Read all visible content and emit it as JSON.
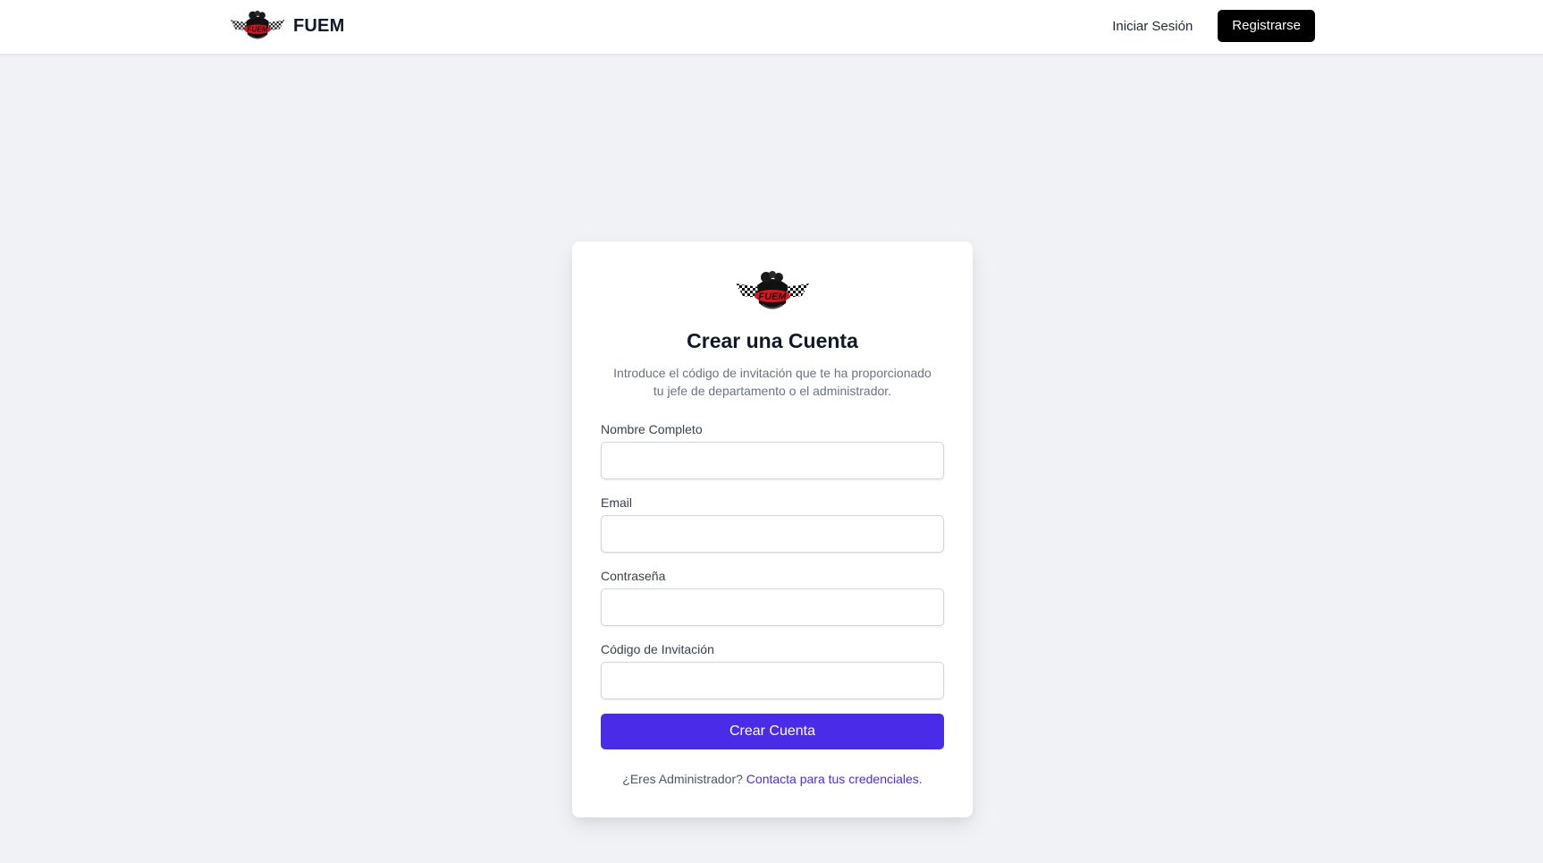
{
  "header": {
    "brand_name": "FUEM",
    "logo_icon": "fuem-racing-logo-icon",
    "nav": {
      "login_label": "Iniciar Sesión",
      "register_label": "Registrarse"
    }
  },
  "signup_form": {
    "logo_icon": "fuem-racing-logo-icon",
    "title": "Crear una Cuenta",
    "subtitle_line1": "Introduce el código de invitación que te ha proporcionado",
    "subtitle_line2": "tu jefe de departamento o el administrador.",
    "fields": [
      {
        "label": "Nombre Completo",
        "value": ""
      },
      {
        "label": "Email",
        "value": ""
      },
      {
        "label": "Contraseña",
        "value": ""
      },
      {
        "label": "Código de Invitación",
        "value": ""
      }
    ],
    "submit_label": "Crear Cuenta",
    "footer_prefix": "¿Eres Administrador?",
    "footer_link": "Contacta para tus credenciales",
    "footer_suffix": "."
  },
  "colors": {
    "accent": "#4a2be8",
    "background": "#f0f2f5",
    "nav_button": "#000000",
    "logo_red": "#e0141e"
  }
}
